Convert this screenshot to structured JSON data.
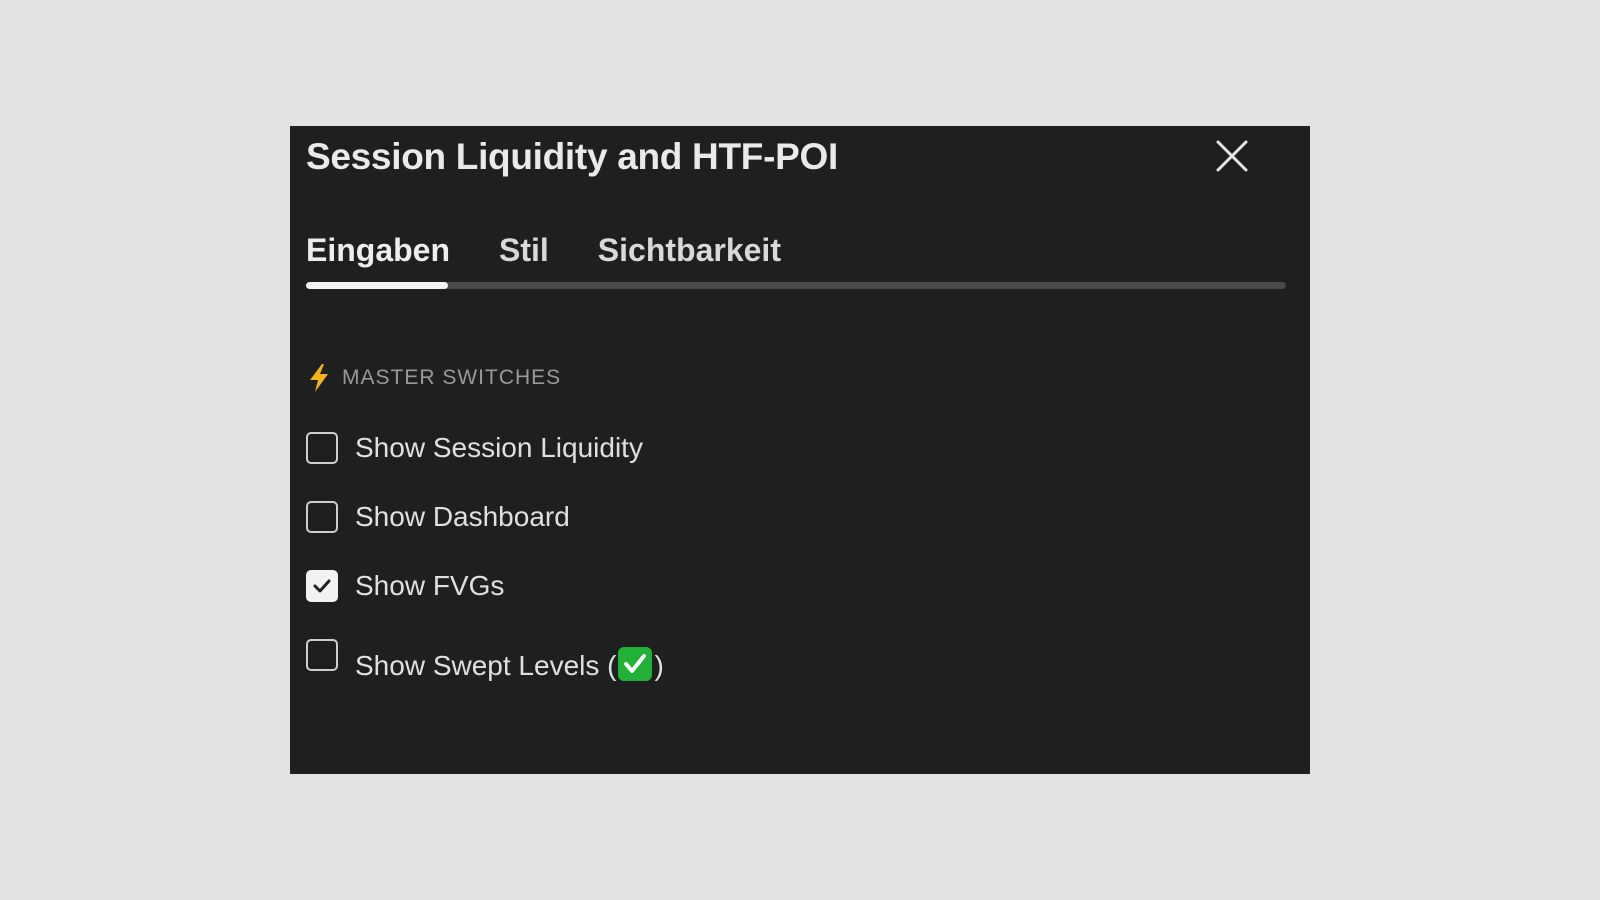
{
  "dialog": {
    "title": "Session Liquidity and HTF-POI",
    "close_icon": "close-icon"
  },
  "tabs": [
    {
      "label": "Eingaben",
      "active": true
    },
    {
      "label": "Stil",
      "active": false
    },
    {
      "label": "Sichtbarkeit",
      "active": false
    }
  ],
  "section": {
    "icon": "lightning-bolt-icon",
    "label": "MASTER SWITCHES"
  },
  "options": [
    {
      "label": "Show Session Liquidity",
      "checked": false
    },
    {
      "label": "Show Dashboard",
      "checked": false
    },
    {
      "label": "Show FVGs",
      "checked": true
    },
    {
      "label_prefix": "Show Swept Levels (",
      "label_suffix": ")",
      "emoji": "green-check-emoji-icon",
      "checked": false
    }
  ],
  "colors": {
    "background": "#e3e3e3",
    "dialog_bg": "#1f1f1f",
    "text": "#e6e6e6",
    "section_label": "#9a9a9a",
    "tab_track": "#4a4a4a",
    "tab_indicator": "#f2f2f2",
    "bolt": "#f5b31a",
    "emoji_green": "#1fb236"
  }
}
